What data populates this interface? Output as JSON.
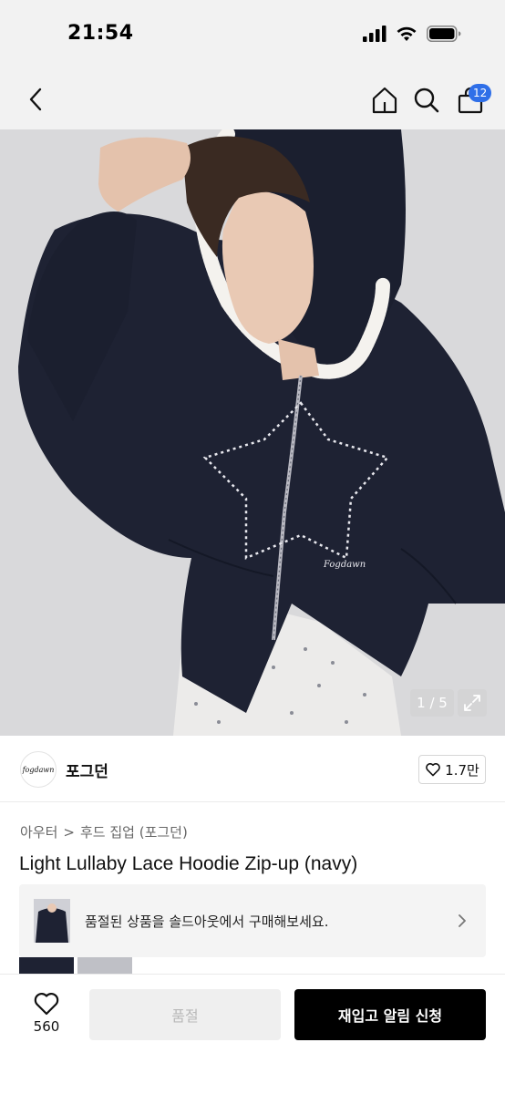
{
  "status_bar": {
    "time": "21:54",
    "icons": [
      "signal-icon",
      "wifi-icon",
      "battery-icon"
    ]
  },
  "nav": {
    "icons": [
      "back-icon",
      "home-icon",
      "search-icon",
      "cart-icon"
    ],
    "cart_count": "12"
  },
  "gallery": {
    "counter": "1 / 5",
    "print_text": "Fogdawn",
    "colors": {
      "background": "#d9d9db",
      "hoodie": "#1e2233",
      "lace": "#f4f2ee"
    }
  },
  "brand": {
    "logo_text": "fogdawn",
    "name": "포그던",
    "likes": "1.7만"
  },
  "breadcrumb": {
    "category": "아우터",
    "separator": ">",
    "subcategory": "후드 집업 (포그던)"
  },
  "product": {
    "title": "Light Lullaby Lace Hoodie Zip-up (navy)"
  },
  "soldout_banner": {
    "text": "품절된 상품을 솔드아웃에서 구매해보세요."
  },
  "bottom_bar": {
    "wish_count": "560",
    "soldout_label": "품절",
    "restock_label": "재입고 알림 신청"
  },
  "colors": {
    "accent": "#2f6fe8",
    "primary_button": "#000000",
    "disabled_button": "#efefef"
  }
}
